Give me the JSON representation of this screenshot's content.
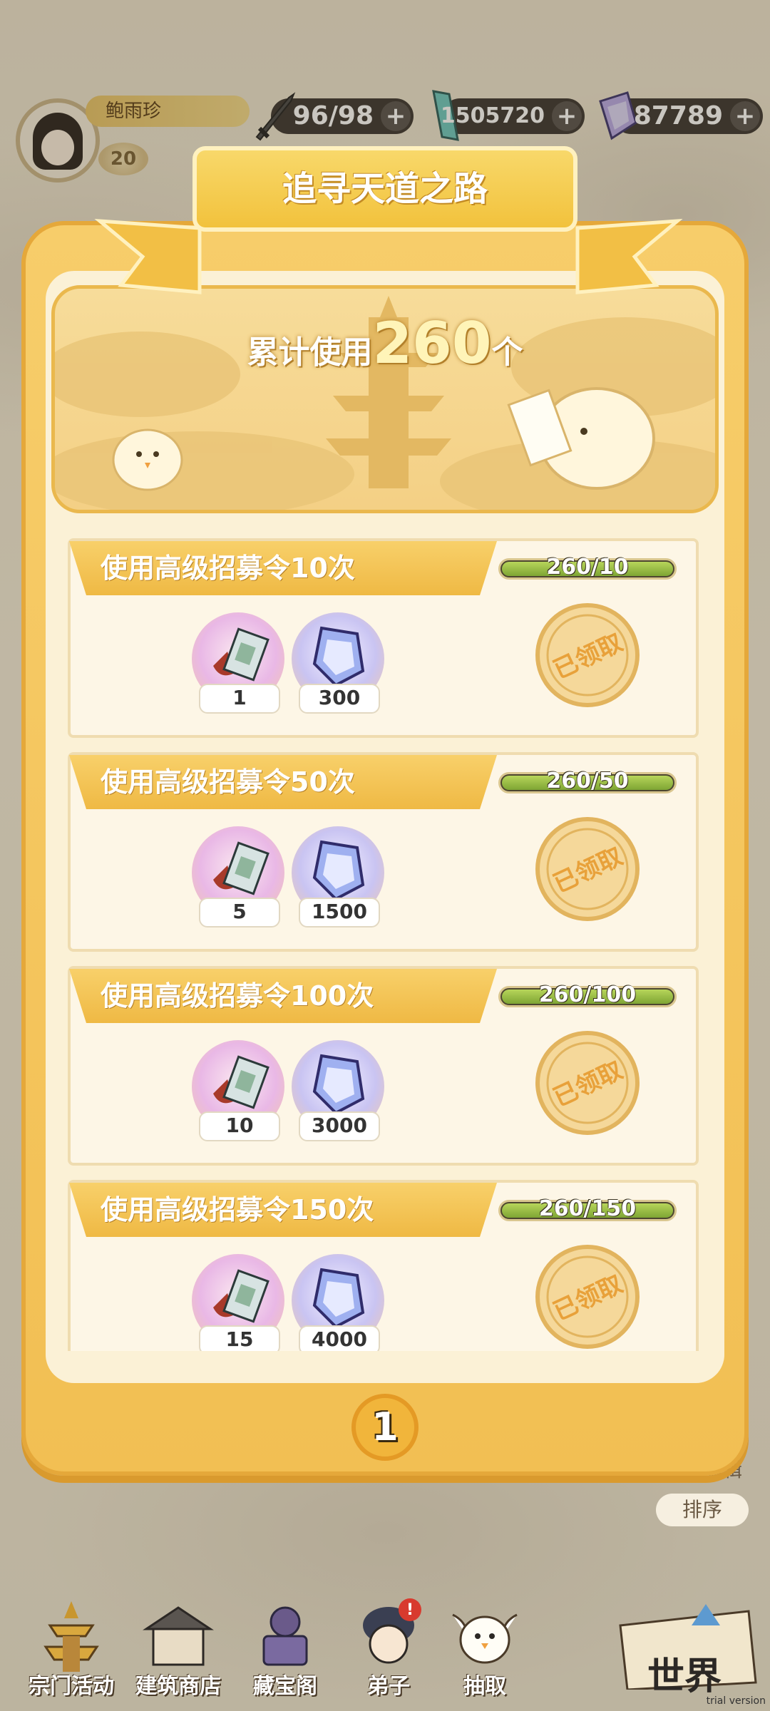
{
  "player": {
    "name": "鲍雨珍",
    "level": "20"
  },
  "resources": {
    "stamina": {
      "value": "96/98",
      "icon": "sword-icon"
    },
    "jade": {
      "value": "1505720",
      "icon": "jade-crystal-icon"
    },
    "gems": {
      "value": "87789",
      "icon": "gem-icon"
    }
  },
  "modal": {
    "title": "追寻天道之路",
    "cumulative_prefix": "累计使用",
    "cumulative_value": "260",
    "cumulative_suffix": "个",
    "page": "1"
  },
  "tasks": [
    {
      "title": "使用高级招募令10次",
      "progress_text": "260/10",
      "progress": 1.0,
      "rewards": [
        {
          "icon": "recruit-token-icon",
          "count": "1"
        },
        {
          "icon": "gem-icon",
          "count": "300"
        }
      ],
      "status": "已领取"
    },
    {
      "title": "使用高级招募令50次",
      "progress_text": "260/50",
      "progress": 1.0,
      "rewards": [
        {
          "icon": "recruit-token-icon",
          "count": "5"
        },
        {
          "icon": "gem-icon",
          "count": "1500"
        }
      ],
      "status": "已领取"
    },
    {
      "title": "使用高级招募令100次",
      "progress_text": "260/100",
      "progress": 1.0,
      "rewards": [
        {
          "icon": "recruit-token-icon",
          "count": "10"
        },
        {
          "icon": "gem-icon",
          "count": "3000"
        }
      ],
      "status": "已领取"
    },
    {
      "title": "使用高级招募令150次",
      "progress_text": "260/150",
      "progress": 1.0,
      "rewards": [
        {
          "icon": "recruit-token-icon",
          "count": "15"
        },
        {
          "icon": "gem-icon",
          "count": "4000"
        }
      ],
      "status": "已领取"
    }
  ],
  "side": {
    "edit_label": "编辑",
    "sort_label": "排序"
  },
  "nav": [
    {
      "label": "宗门活动",
      "icon": "pagoda-icon"
    },
    {
      "label": "建筑商店",
      "icon": "building-icon"
    },
    {
      "label": "藏宝阁",
      "icon": "treasure-icon"
    },
    {
      "label": "弟子",
      "icon": "disciple-icon"
    },
    {
      "label": "抽取",
      "icon": "chick-icon"
    },
    {
      "label": "世界",
      "icon": "map-icon"
    }
  ],
  "watermark": "trial version"
}
